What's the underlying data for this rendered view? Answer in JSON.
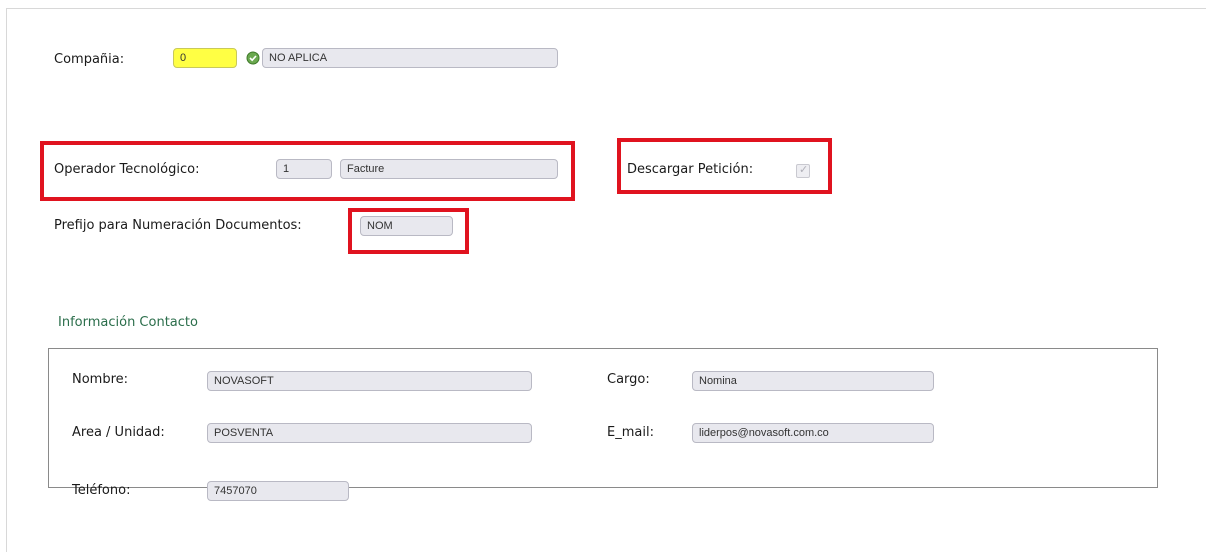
{
  "company": {
    "label": "Compañia:",
    "code": "0",
    "name": "NO APLICA",
    "icon": "green-status-icon"
  },
  "operator": {
    "label": "Operador Tecnológico:",
    "code": "1",
    "name": "Facture"
  },
  "download_request": {
    "label": "Descargar Petición:",
    "checked": true
  },
  "prefix": {
    "label": "Prefijo para Numeración Documentos:",
    "value": "NOM"
  },
  "contact": {
    "title": "Información Contacto",
    "name_label": "Nombre:",
    "name_value": "NOVASOFT",
    "position_label": "Cargo:",
    "position_value": "Nomina",
    "area_label": "Area / Unidad:",
    "area_value": "POSVENTA",
    "email_label": "E_mail:",
    "email_value": "liderpos@novasoft.com.co",
    "phone_label": "Teléfono:",
    "phone_value": "7457070"
  },
  "colors": {
    "highlight": "#e0131f",
    "section_title": "#2b6e4b",
    "code_field": "#ffff44"
  }
}
